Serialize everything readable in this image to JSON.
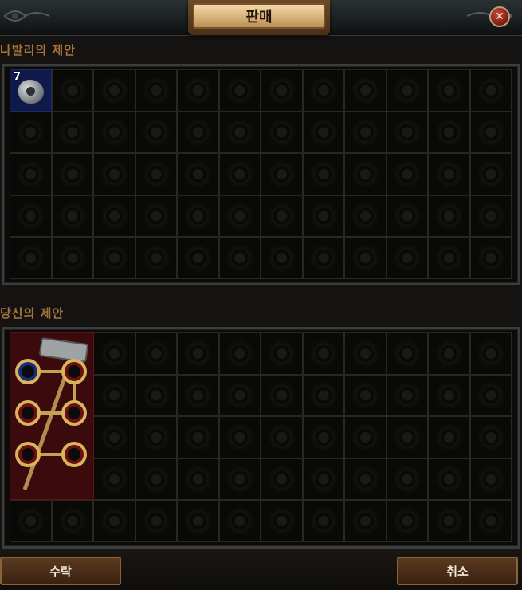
{
  "window": {
    "title": "판매",
    "close_label": "✕"
  },
  "their_offer": {
    "label": "나발리의 제안",
    "rows": 5,
    "cols": 12,
    "items": [
      {
        "name": "orb-currency",
        "stack": "7",
        "size": [
          1,
          1
        ]
      }
    ]
  },
  "your_offer": {
    "label": "당신의 제안",
    "rows": 5,
    "cols": 12,
    "items": [
      {
        "name": "two-hand-hammer",
        "size": [
          2,
          4
        ],
        "sockets": [
          "blue",
          "red",
          "red",
          "red",
          "red",
          "red"
        ]
      }
    ]
  },
  "buttons": {
    "accept": "수락",
    "cancel": "취소"
  },
  "colors": {
    "accent": "#a8733a",
    "magic_bg": "#101a4a",
    "owned_bg": "#3a0a0c"
  }
}
